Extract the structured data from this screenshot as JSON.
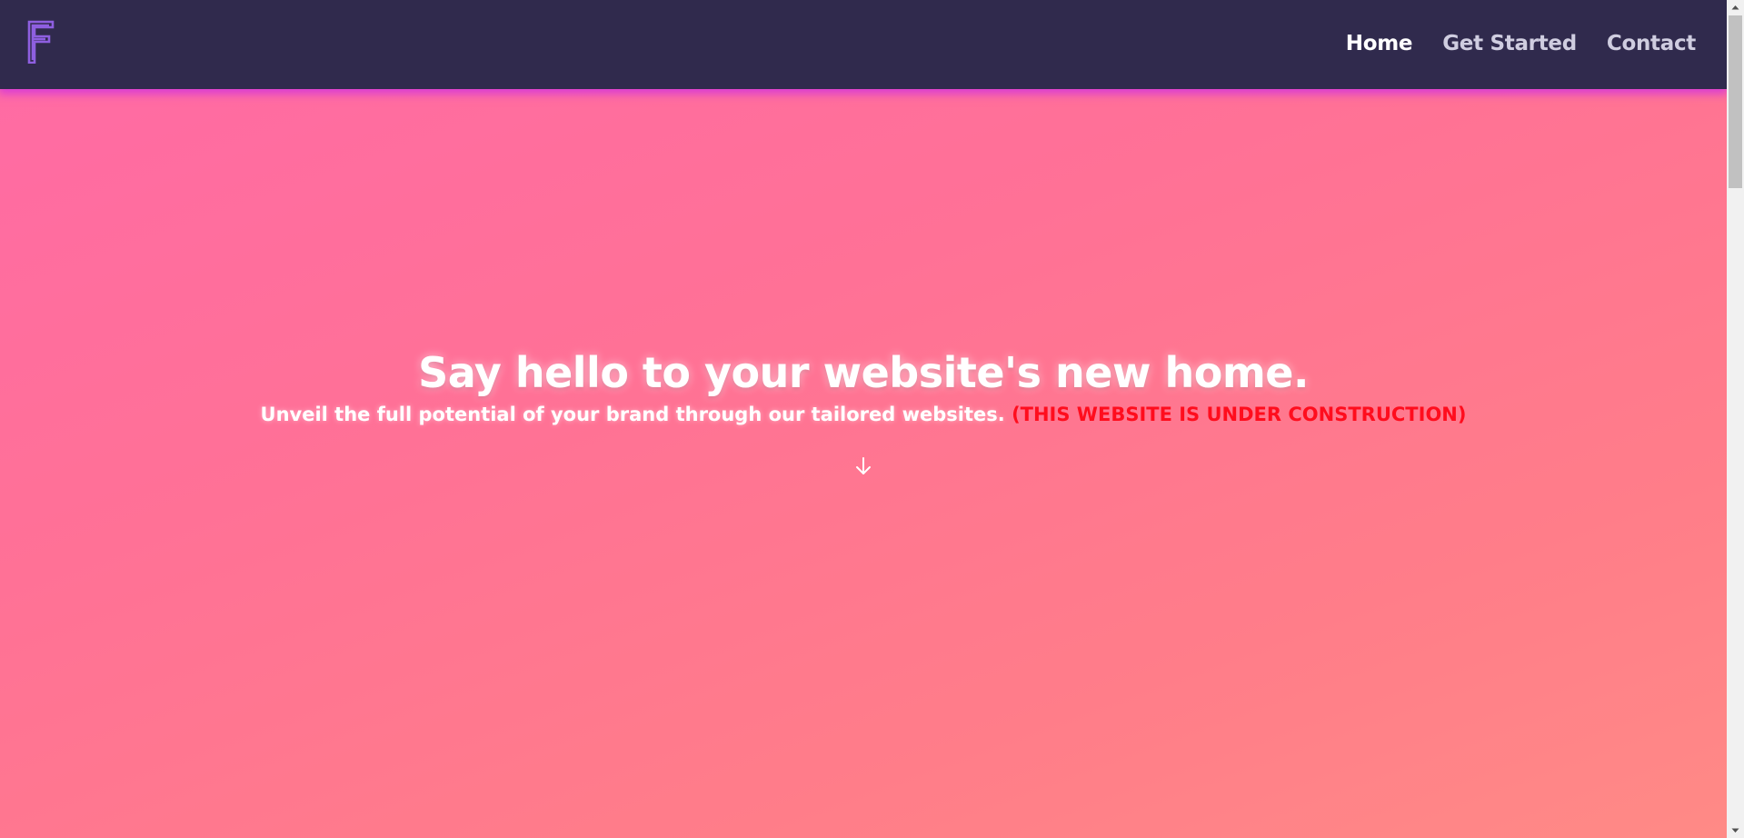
{
  "brand": {
    "logo_icon": "f-monogram-icon",
    "logo_color": "#8e5fe0"
  },
  "nav": {
    "items": [
      {
        "label": "Home",
        "active": true
      },
      {
        "label": "Get Started",
        "active": false
      },
      {
        "label": "Contact",
        "active": false
      }
    ]
  },
  "hero": {
    "title": "Say hello to your website's new home.",
    "subtitle": "Unveil the full potential of your brand through our tailored websites.",
    "notice": "(THIS WEBSITE IS UNDER CONSTRUCTION)",
    "scroll_icon": "arrow-down-icon"
  },
  "colors": {
    "navbar_bg": "#302a4d",
    "navbar_glow": "#d83ad8",
    "notice": "#ff0d1d",
    "gradient_start": "#ff6aa6",
    "gradient_end": "#ff8a86"
  }
}
